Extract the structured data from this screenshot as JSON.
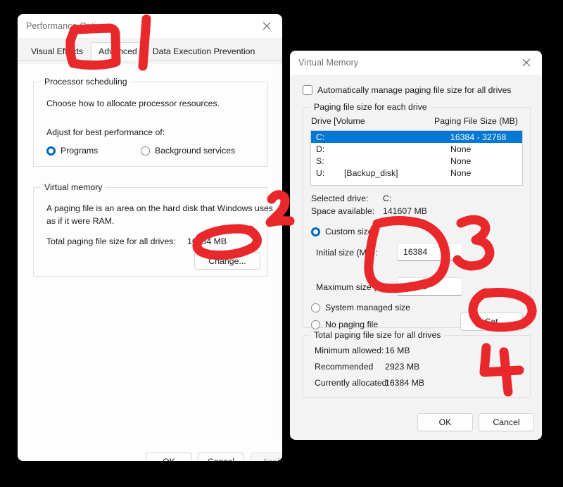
{
  "performance_options": {
    "title": "Performance Options",
    "close_icon": "close-icon",
    "tabs": [
      {
        "label": "Visual Effects",
        "active": false
      },
      {
        "label": "Advanced",
        "active": true
      },
      {
        "label": "Data Execution Prevention",
        "active": false
      }
    ],
    "processor_scheduling": {
      "legend": "Processor scheduling",
      "description": "Choose how to allocate processor resources.",
      "adjust_label": "Adjust for best performance of:",
      "options": [
        {
          "label": "Programs",
          "checked": true
        },
        {
          "label": "Background services",
          "checked": false
        }
      ]
    },
    "virtual_memory": {
      "legend": "Virtual memory",
      "description_line1": "A paging file is an area on the hard disk that Windows uses",
      "description_line2": "as if it were RAM.",
      "total_label": "Total paging file size for all drives:",
      "total_value": "16384 MB",
      "change_button": "Change..."
    },
    "footer": {
      "ok": "OK",
      "cancel": "Cancel",
      "apply": "Apply"
    }
  },
  "virtual_memory_dialog": {
    "title": "Virtual Memory",
    "close_icon": "close-icon",
    "auto_manage": {
      "label": "Automatically manage paging file size for all drives",
      "checked": false
    },
    "paging_group": {
      "legend": "Paging file size for each drive",
      "columns": [
        "Drive  [Volume",
        "Paging File Size (MB)"
      ],
      "rows": [
        {
          "drive": "C:",
          "volume": "",
          "size": "16384 - 32768",
          "selected": true
        },
        {
          "drive": "D:",
          "volume": "",
          "size": "None",
          "selected": false
        },
        {
          "drive": "S:",
          "volume": "",
          "size": "None",
          "selected": false
        },
        {
          "drive": "U:",
          "volume": "[Backup_disk]",
          "size": "None",
          "selected": false
        }
      ],
      "selected_drive_label": "Selected drive:",
      "selected_drive_value": "C:",
      "space_available_label": "Space available:",
      "space_available_value": "141607 MB",
      "custom_size": {
        "label": "Custom size:",
        "checked": true
      },
      "initial_size_label": "Initial size (MB):",
      "initial_size_value": "16384",
      "maximum_size_label": "Maximum size (MB):",
      "maximum_size_value": "32768",
      "system_managed": {
        "label": "System managed size",
        "checked": false
      },
      "no_paging_file": {
        "label": "No paging file",
        "checked": false
      },
      "set_button": "Set"
    },
    "totals_group": {
      "legend": "Total paging file size for all drives",
      "rows": [
        {
          "label": "Minimum allowed:",
          "value": "16 MB"
        },
        {
          "label": "Recommended",
          "value": "2923 MB"
        },
        {
          "label": "Currently allocated:",
          "value": "16384 MB"
        }
      ]
    },
    "footer": {
      "ok": "OK",
      "cancel": "Cancel"
    }
  },
  "annotations": {
    "color": "#e8282a",
    "marks": [
      {
        "name": "step-1-box-advanced-tab",
        "type": "rectangle",
        "step": ""
      },
      {
        "name": "step-1-digit",
        "type": "digit",
        "step": "1"
      },
      {
        "name": "step-2-circle-change-button",
        "type": "ellipse",
        "step": ""
      },
      {
        "name": "step-2-digit",
        "type": "digit",
        "step": "2"
      },
      {
        "name": "step-3-circle-size-fields",
        "type": "ellipse",
        "step": ""
      },
      {
        "name": "step-3-digit",
        "type": "digit",
        "step": "3"
      },
      {
        "name": "step-4-circle-set-button",
        "type": "ellipse",
        "step": ""
      },
      {
        "name": "step-4-digit",
        "type": "digit",
        "step": "4"
      }
    ]
  }
}
